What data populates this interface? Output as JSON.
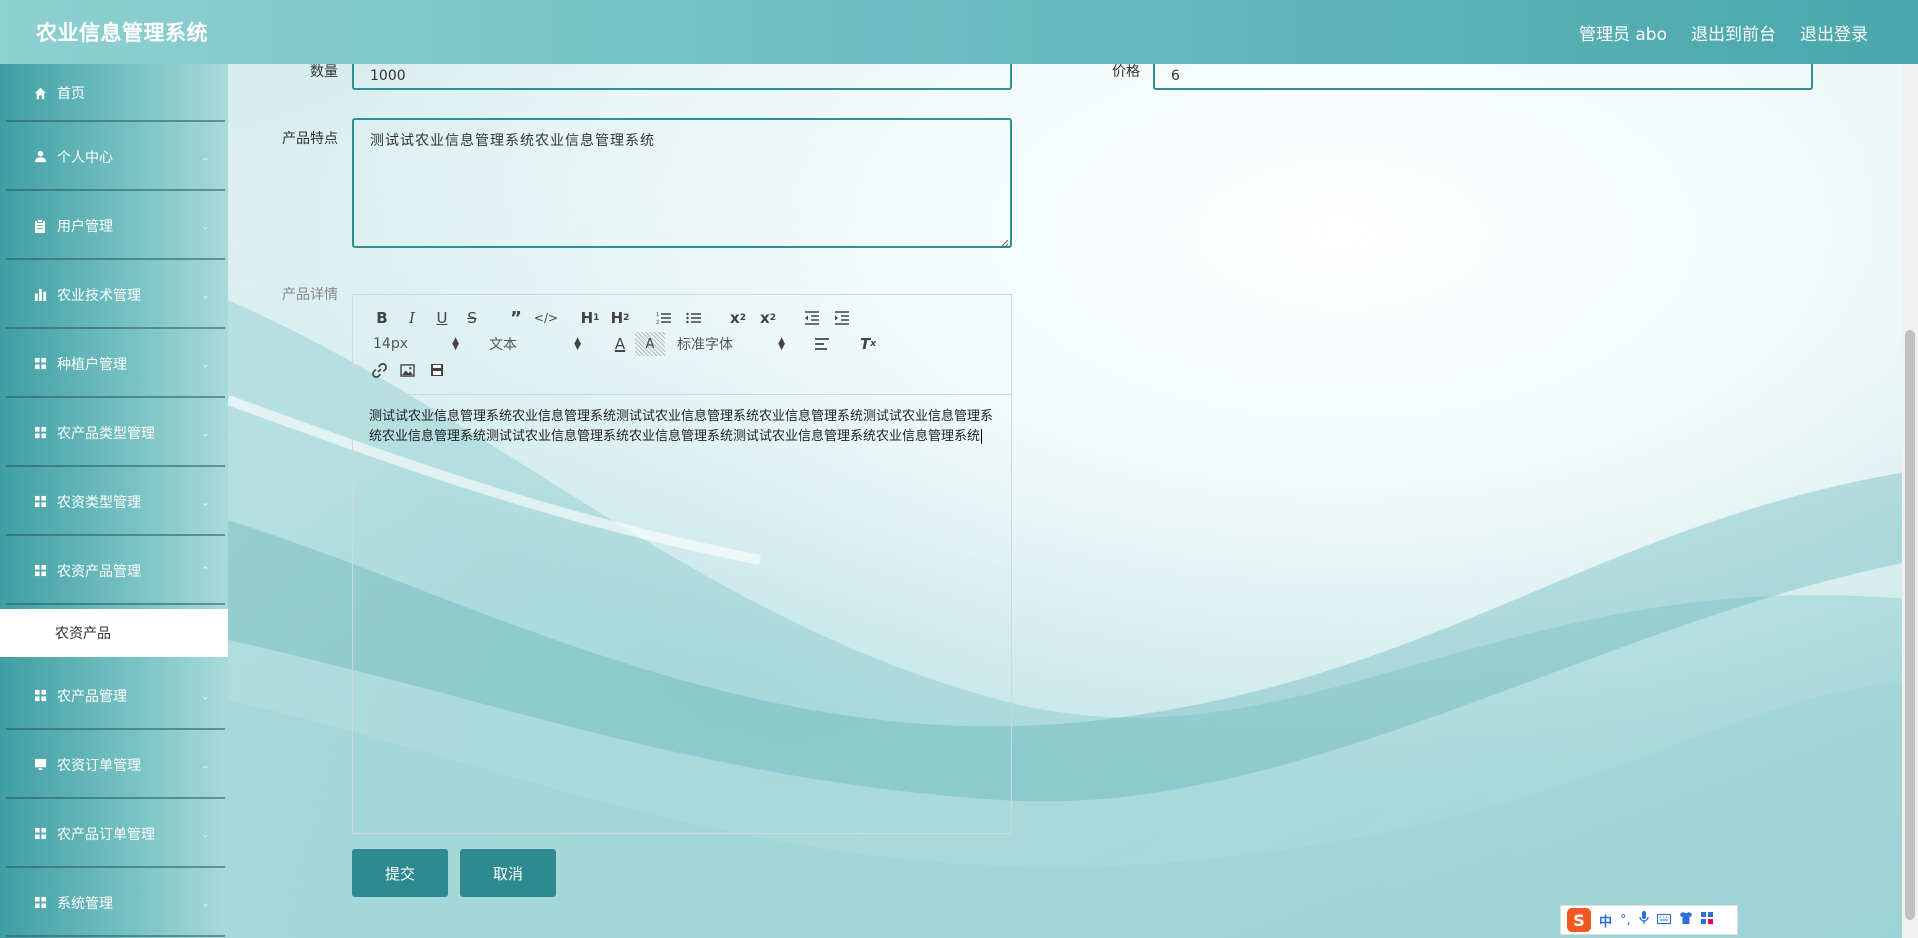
{
  "app": {
    "title": "农业信息管理系统"
  },
  "header": {
    "user_label": "管理员 abo",
    "frontend_link": "退出到前台",
    "logout_link": "退出登录"
  },
  "sidebar": {
    "items": [
      {
        "label": "首页",
        "icon": "home-icon"
      },
      {
        "label": "个人中心",
        "icon": "user-icon"
      },
      {
        "label": "用户管理",
        "icon": "clipboard-icon"
      },
      {
        "label": "农业技术管理",
        "icon": "bar-chart-icon"
      },
      {
        "label": "种植户管理",
        "icon": "grid-icon"
      },
      {
        "label": "农产品类型管理",
        "icon": "grid-icon"
      },
      {
        "label": "农资类型管理",
        "icon": "grid-icon"
      },
      {
        "label": "农资产品管理",
        "icon": "grid-icon"
      },
      {
        "label": "农产品管理",
        "icon": "grid-icon"
      },
      {
        "label": "农资订单管理",
        "icon": "monitor-icon"
      },
      {
        "label": "农产品订单管理",
        "icon": "grid-icon"
      },
      {
        "label": "系统管理",
        "icon": "grid-icon"
      }
    ],
    "active_sub_item": "农资产品"
  },
  "form": {
    "quantity": {
      "label": "数量",
      "value": "1000"
    },
    "price": {
      "label": "价格",
      "value": "6"
    },
    "features": {
      "label": "产品特点",
      "value": "测试试农业信息管理系统农业信息管理系统"
    },
    "details": {
      "label": "产品详情",
      "toolbar": {
        "font_size": "14px",
        "text_style": "文本",
        "font_family": "标准字体"
      },
      "content": "测试试农业信息管理系统农业信息管理系统测试试农业信息管理系统农业信息管理系统测试试农业信息管理系统农业信息管理系统测试试农业信息管理系统农业信息管理系统测试试农业信息管理系统农业信息管理系统"
    },
    "submit_label": "提交",
    "cancel_label": "取消"
  },
  "ime": {
    "mode": "中"
  },
  "colors": {
    "accent": "#2d8a8e",
    "header_start": "#8fd0d2",
    "header_end": "#4aa7ab"
  }
}
